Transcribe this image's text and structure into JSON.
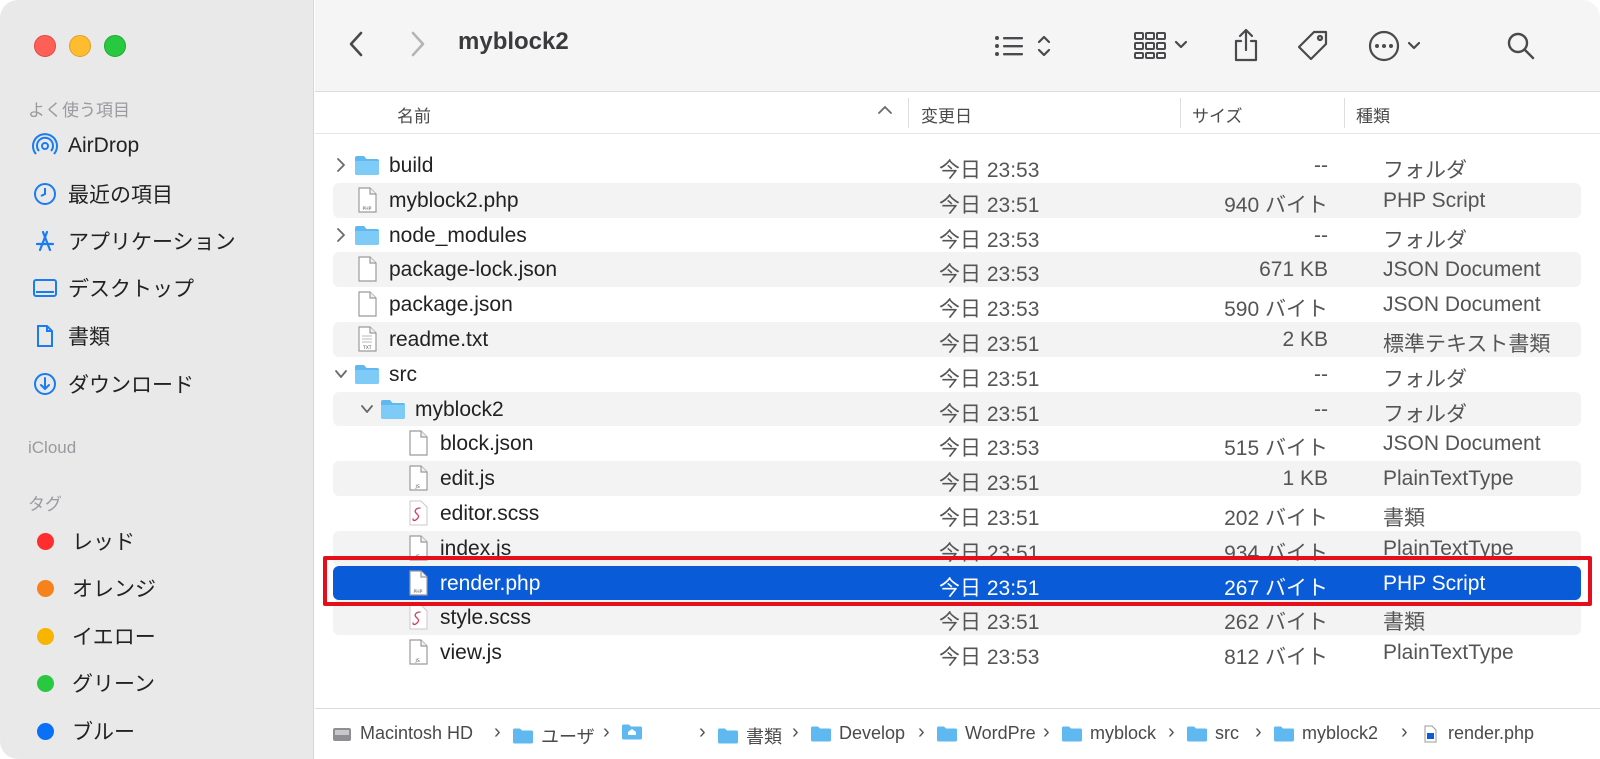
{
  "window": {
    "title": "myblock2"
  },
  "sidebar": {
    "favorites_header": "よく使う項目",
    "favorites": [
      {
        "label": "AirDrop",
        "icon": "airdrop-icon"
      },
      {
        "label": "最近の項目",
        "icon": "clock-icon"
      },
      {
        "label": "アプリケーション",
        "icon": "applications-icon"
      },
      {
        "label": "デスクトップ",
        "icon": "desktop-icon"
      },
      {
        "label": "書類",
        "icon": "document-icon"
      },
      {
        "label": "ダウンロード",
        "icon": "download-icon"
      }
    ],
    "icloud_header": "iCloud",
    "tags_header": "タグ",
    "tags": [
      {
        "label": "レッド",
        "color": "#ff2d2d"
      },
      {
        "label": "オレンジ",
        "color": "#f7821b"
      },
      {
        "label": "イエロー",
        "color": "#f7b500"
      },
      {
        "label": "グリーン",
        "color": "#28c840"
      },
      {
        "label": "ブルー",
        "color": "#0a70f5"
      }
    ]
  },
  "columns": {
    "name": "名前",
    "date": "変更日",
    "size": "サイズ",
    "kind": "種類"
  },
  "files": [
    {
      "name": "build",
      "date": "今日 23:53",
      "size": "--",
      "kind": "フォルダ",
      "type": "folder",
      "level": 0,
      "disclosure": "collapsed"
    },
    {
      "name": "myblock2.php",
      "date": "今日 23:51",
      "size": "940 バイト",
      "kind": "PHP Script",
      "type": "php",
      "level": 0
    },
    {
      "name": "node_modules",
      "date": "今日 23:53",
      "size": "--",
      "kind": "フォルダ",
      "type": "folder",
      "level": 0,
      "disclosure": "collapsed"
    },
    {
      "name": "package-lock.json",
      "date": "今日 23:53",
      "size": "671 KB",
      "kind": "JSON Document",
      "type": "doc",
      "level": 0
    },
    {
      "name": "package.json",
      "date": "今日 23:53",
      "size": "590 バイト",
      "kind": "JSON Document",
      "type": "doc",
      "level": 0
    },
    {
      "name": "readme.txt",
      "date": "今日 23:51",
      "size": "2 KB",
      "kind": "標準テキスト書類",
      "type": "txt",
      "level": 0
    },
    {
      "name": "src",
      "date": "今日 23:51",
      "size": "--",
      "kind": "フォルダ",
      "type": "folder",
      "level": 0,
      "disclosure": "expanded"
    },
    {
      "name": "myblock2",
      "date": "今日 23:51",
      "size": "--",
      "kind": "フォルダ",
      "type": "folder",
      "level": 1,
      "disclosure": "expanded"
    },
    {
      "name": "block.json",
      "date": "今日 23:53",
      "size": "515 バイト",
      "kind": "JSON Document",
      "type": "doc",
      "level": 2
    },
    {
      "name": "edit.js",
      "date": "今日 23:51",
      "size": "1 KB",
      "kind": "PlainTextType",
      "type": "js",
      "level": 2
    },
    {
      "name": "editor.scss",
      "date": "今日 23:51",
      "size": "202 バイト",
      "kind": "書類",
      "type": "scss",
      "level": 2
    },
    {
      "name": "index.js",
      "date": "今日 23:51",
      "size": "934 バイト",
      "kind": "PlainTextType",
      "type": "js",
      "level": 2
    },
    {
      "name": "render.php",
      "date": "今日 23:51",
      "size": "267 バイト",
      "kind": "PHP Script",
      "type": "php",
      "level": 2,
      "selected": true
    },
    {
      "name": "style.scss",
      "date": "今日 23:51",
      "size": "262 バイト",
      "kind": "書類",
      "type": "scss",
      "level": 2
    },
    {
      "name": "view.js",
      "date": "今日 23:53",
      "size": "812 バイト",
      "kind": "PlainTextType",
      "type": "js",
      "level": 2
    }
  ],
  "pathbar": [
    {
      "label": "Macintosh HD",
      "icon": "hard-drive-icon"
    },
    {
      "label": "ユーザ",
      "icon": "folder-icon"
    },
    {
      "label": "",
      "icon": "home-folder-icon"
    },
    {
      "label": "書類",
      "icon": "folder-icon"
    },
    {
      "label": "Develop",
      "icon": "folder-icon"
    },
    {
      "label": "WordPre",
      "icon": "folder-icon"
    },
    {
      "label": "myblock",
      "icon": "folder-icon"
    },
    {
      "label": "src",
      "icon": "folder-icon"
    },
    {
      "label": "myblock2",
      "icon": "folder-icon"
    },
    {
      "label": "render.php",
      "icon": "php-file-icon"
    }
  ],
  "colors": {
    "selection": "#0a5bd8",
    "highlight_box": "#e3101b",
    "folder": "#5fb8f0"
  }
}
